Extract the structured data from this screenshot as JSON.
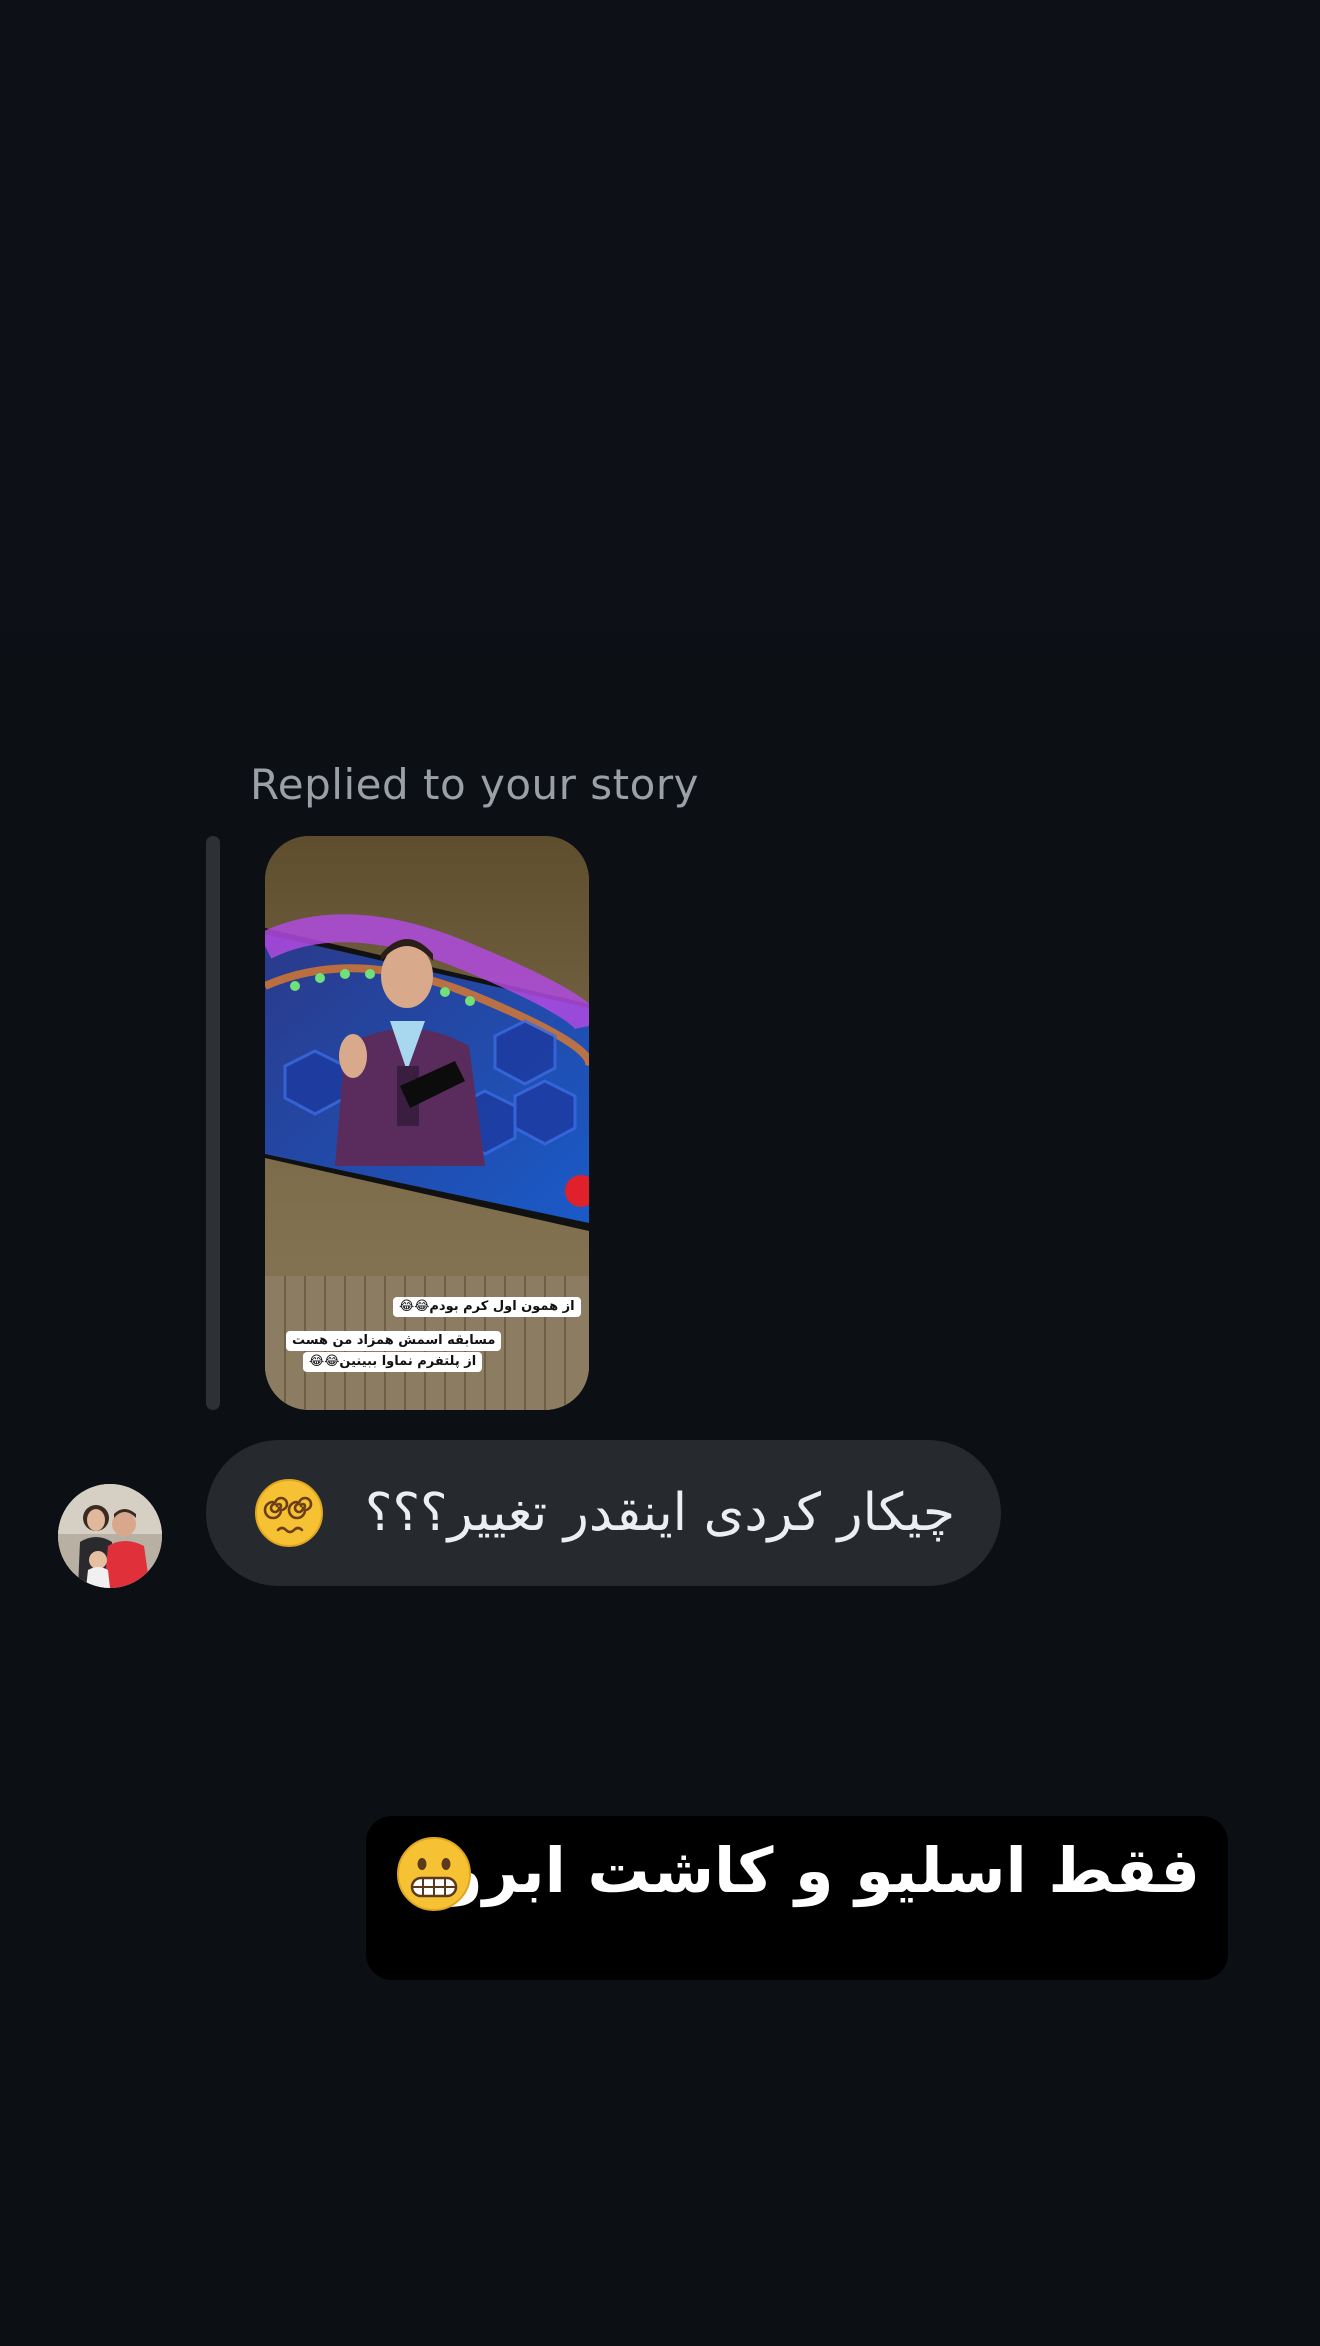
{
  "thread": {
    "reply_caption": "Replied to your story",
    "story": {
      "sticker_line_1": "از همون اول کرم بودم😂😂",
      "sticker_line_2": "مسابقه اسمش همزاد من هست",
      "sticker_line_3": "از پلتفرم نماوا ببینین😂😂"
    },
    "incoming_message": {
      "text": "چیکار کردی اینقدر تغییر؟؟؟",
      "emoji": "face-with-spiral-eyes-icon"
    },
    "outgoing_message": {
      "text": "فقط اسلیو و کاشت ابرو",
      "emoji": "grimacing-face-icon"
    }
  },
  "colors": {
    "background": "#0c0f14",
    "incoming_bubble": "#26292e",
    "outgoing_bubble": "#000000",
    "caption_text": "#9aa0a6"
  }
}
